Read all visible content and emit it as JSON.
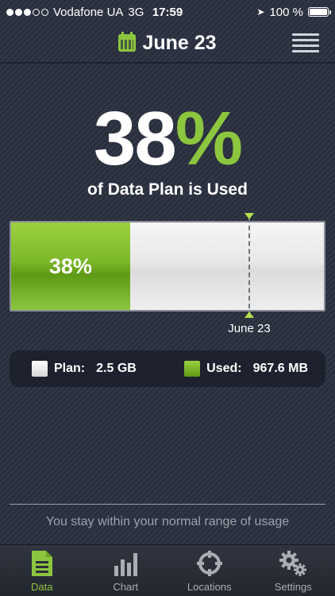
{
  "status_bar": {
    "carrier": "Vodafone UA",
    "network": "3G",
    "time": "17:59",
    "battery": "100 %"
  },
  "header": {
    "title": "June 23",
    "calendar_icon": "calendar-icon",
    "menu_icon": "hamburger-menu-icon"
  },
  "usage": {
    "percent_number": "38",
    "percent_sign": "%",
    "subtitle": "of Data Plan is Used",
    "bar_label": "38%",
    "fill_fraction": 0.38,
    "today_fraction": 0.755,
    "today_label": "June 23"
  },
  "legend": {
    "plan_label": "Plan:",
    "plan_value": "2.5 GB",
    "used_label": "Used:",
    "used_value": "967.6 MB"
  },
  "footer": {
    "message": "You stay within your normal range of usage"
  },
  "tabs": [
    {
      "label": "Data",
      "icon": "document-icon",
      "active": true
    },
    {
      "label": "Chart",
      "icon": "bar-chart-icon",
      "active": false
    },
    {
      "label": "Locations",
      "icon": "crosshair-icon",
      "active": false
    },
    {
      "label": "Settings",
      "icon": "gears-icon",
      "active": false
    }
  ],
  "colors": {
    "accent": "#8cc63f",
    "background": "#2b3140",
    "tab_inactive": "#a9adb5"
  }
}
